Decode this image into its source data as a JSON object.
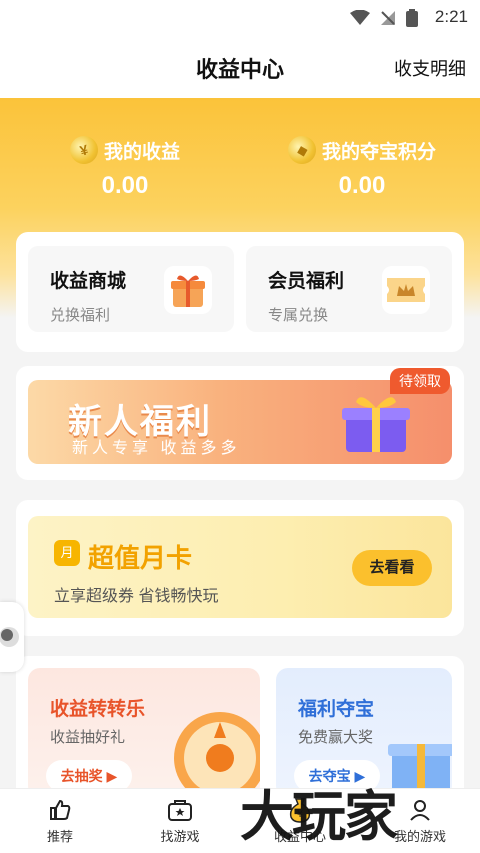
{
  "status": {
    "time": "2:21"
  },
  "header": {
    "title": "收益中心",
    "detail": "收支明细"
  },
  "earnings": [
    {
      "label": "我的收益",
      "value": "0.00"
    },
    {
      "label": "我的夺宝积分",
      "value": "0.00"
    }
  ],
  "shortcuts": [
    {
      "title": "收益商城",
      "sub": "兑换福利"
    },
    {
      "title": "会员福利",
      "sub": "专属兑换"
    }
  ],
  "newbie": {
    "badge": "待领取",
    "title": "新人福利",
    "sub": "新人专享  收益多多"
  },
  "monthly": {
    "icon": "月",
    "title": "超值月卡",
    "sub": "立享超级券 省钱畅快玩",
    "button": "去看看"
  },
  "activities": [
    {
      "title": "收益转转乐",
      "sub": "收益抽好礼",
      "button": "去抽奖",
      "color": "#e8542a"
    },
    {
      "title": "福利夺宝",
      "sub": "免费赢大奖",
      "button": "去夺宝",
      "color": "#2f6fd8"
    }
  ],
  "tabs": [
    {
      "label": "推荐"
    },
    {
      "label": "找游戏"
    },
    {
      "label": "收益中心"
    },
    {
      "label": "我的游戏"
    }
  ],
  "watermark": "大玩家"
}
